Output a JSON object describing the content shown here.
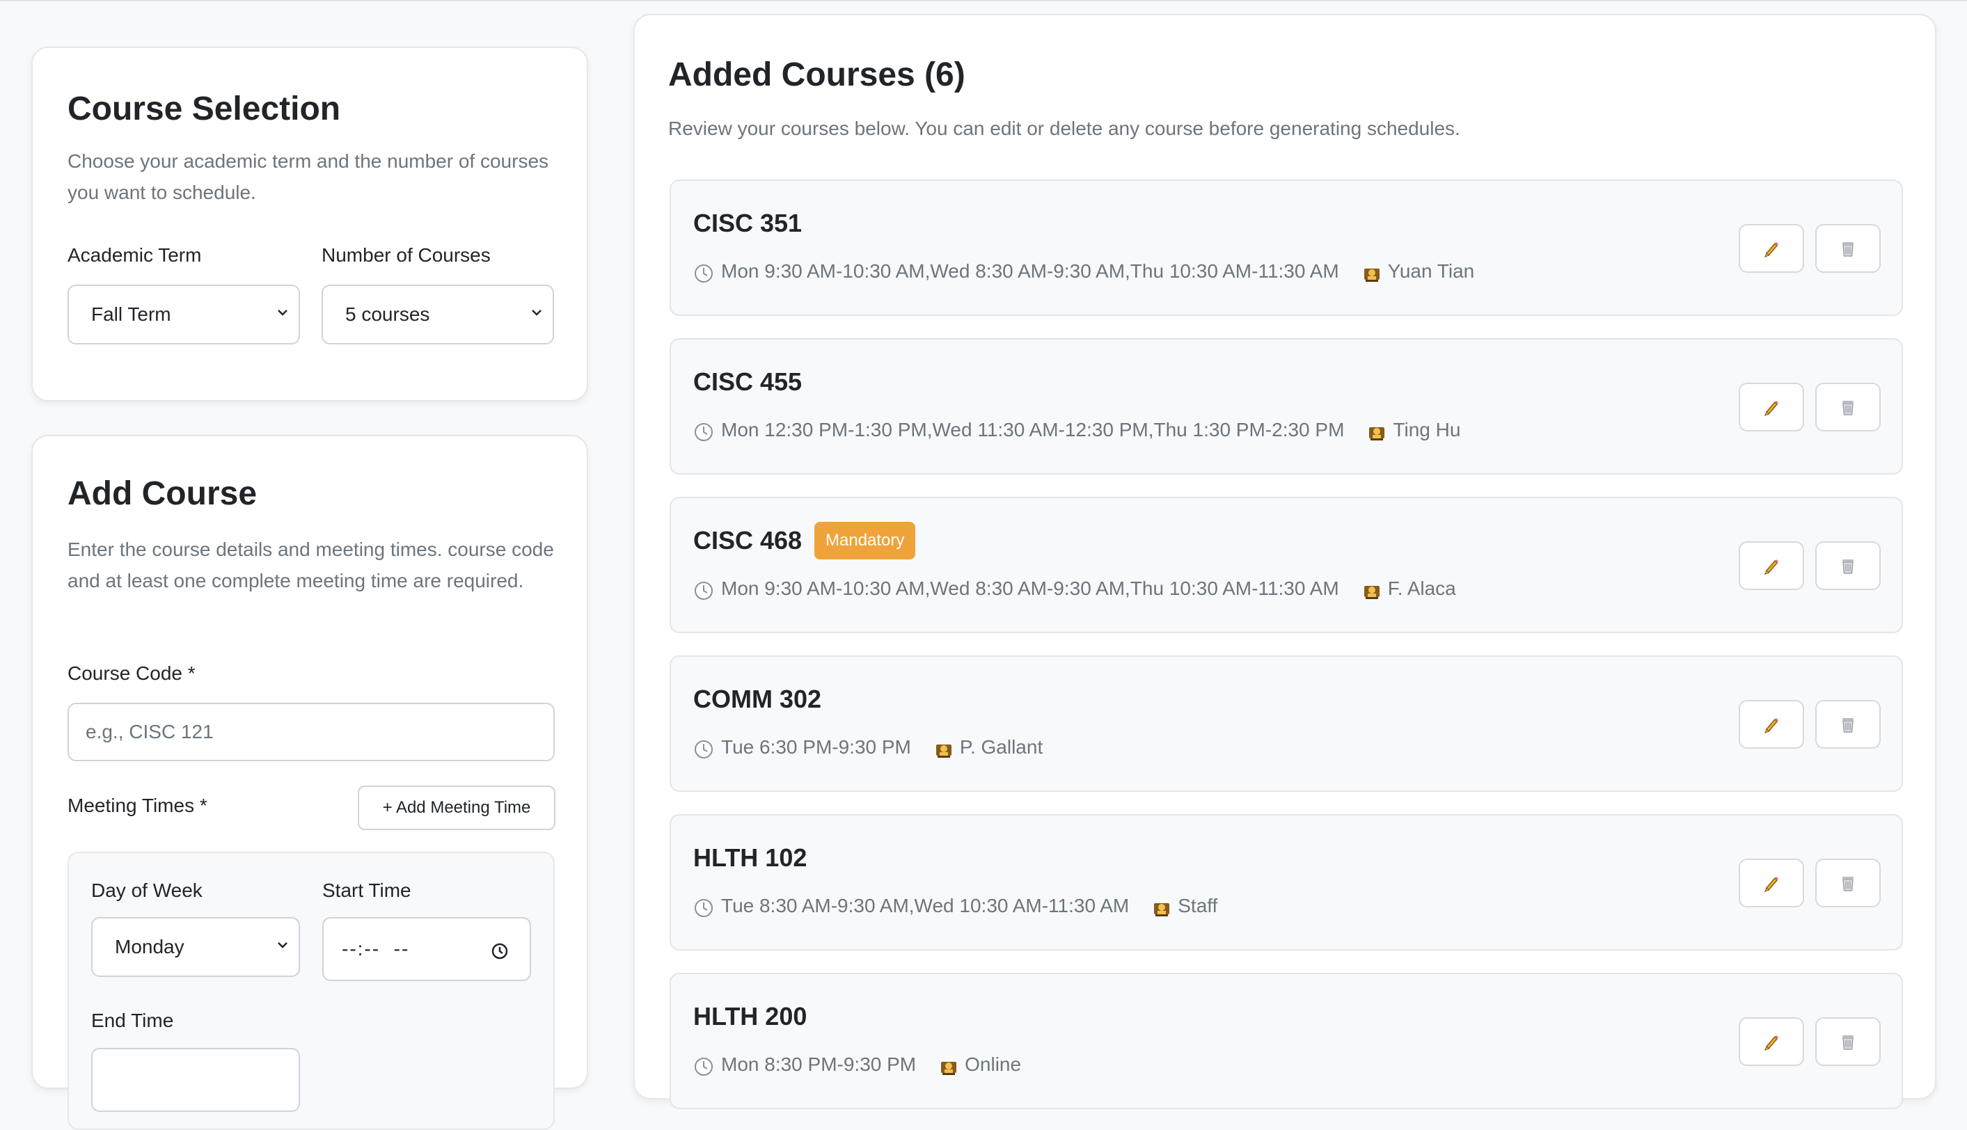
{
  "course_selection": {
    "title": "Course Selection",
    "description": "Choose your academic term and the number of courses you want to schedule.",
    "term_label": "Academic Term",
    "term_value": "Fall Term",
    "num_label": "Number of Courses",
    "num_value": "5 courses"
  },
  "add_course": {
    "title": "Add Course",
    "description": "Enter the course details and meeting times. course code and at least one complete meeting time are required.",
    "code_label": "Course Code *",
    "code_placeholder": "e.g., CISC 121",
    "meeting_label": "Meeting Times *",
    "add_meeting_button": "+ Add Meeting Time",
    "day_label": "Day of Week",
    "day_value": "Monday",
    "start_label": "Start Time",
    "start_value": "--:--  --",
    "end_label": "End Time"
  },
  "added_courses": {
    "title": "Added Courses (6)",
    "description": "Review your courses below. You can edit or delete any course before generating schedules.",
    "courses": [
      {
        "code": "CISC 351",
        "times": "Mon 9:30 AM-10:30 AM,Wed 8:30 AM-9:30 AM,Thu 10:30 AM-11:30 AM",
        "instructor": "Yuan Tian"
      },
      {
        "code": "CISC 455",
        "times": "Mon 12:30 PM-1:30 PM,Wed 11:30 AM-12:30 PM,Thu 1:30 PM-2:30 PM",
        "instructor": "Ting Hu"
      },
      {
        "code": "CISC 468",
        "badge": "Mandatory",
        "times": "Mon 9:30 AM-10:30 AM,Wed 8:30 AM-9:30 AM,Thu 10:30 AM-11:30 AM",
        "instructor": "F. Alaca"
      },
      {
        "code": "COMM 302",
        "times": "Tue 6:30 PM-9:30 PM",
        "instructor": "P. Gallant"
      },
      {
        "code": "HLTH 102",
        "times": "Tue 8:30 AM-9:30 AM,Wed 10:30 AM-11:30 AM",
        "instructor": "Staff"
      },
      {
        "code": "HLTH 200",
        "times": "Mon 8:30 PM-9:30 PM",
        "instructor": "Online"
      }
    ]
  },
  "colors": {
    "badge": "#f0a33a",
    "text": "#212529",
    "muted": "#6c757d",
    "border": "#ced4da"
  },
  "icons": {
    "clock": "clock-icon",
    "instructor": "teacher-icon",
    "edit": "pencil-icon",
    "delete": "trash-icon",
    "chevron": "chevron-down-icon",
    "time": "clock-icon"
  }
}
